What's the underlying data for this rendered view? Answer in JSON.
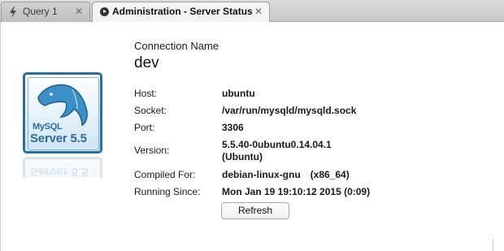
{
  "tabs": [
    {
      "label": "Query 1",
      "icon": "lightning-icon",
      "active": false,
      "close": "✕"
    },
    {
      "label": "Administration - Server Status",
      "icon": "play-circle-icon",
      "active": true,
      "close": "✕"
    }
  ],
  "logo": {
    "brand": "MySQL",
    "product": "Server 5.5",
    "accent_color": "#2b6e9e"
  },
  "connection": {
    "label": "Connection Name",
    "name": "dev"
  },
  "info": {
    "host": {
      "label": "Host:",
      "value": "ubuntu"
    },
    "socket": {
      "label": "Socket:",
      "value": "/var/run/mysqld/mysqld.sock"
    },
    "port": {
      "label": "Port:",
      "value": "3306"
    },
    "version": {
      "label": "Version:",
      "value_line1": "5.5.40-0ubuntu0.14.04.1",
      "value_line2": "(Ubuntu)"
    },
    "compiled_for": {
      "label": "Compiled For:",
      "value": "debian-linux-gnu",
      "arch": "(x86_64)"
    },
    "running_since": {
      "label": "Running Since:",
      "value": "Mon Jan 19 19:10:12 2015 (0:09)"
    }
  },
  "refresh_button": "Refresh"
}
